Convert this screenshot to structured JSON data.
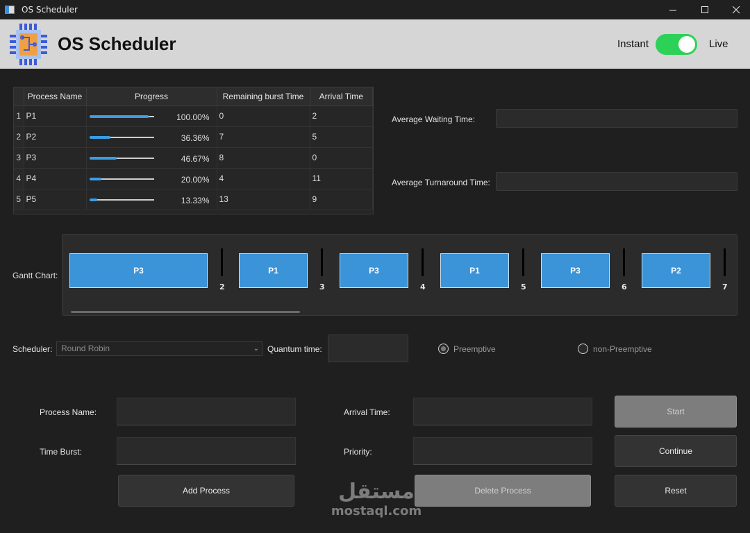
{
  "window": {
    "title": "OS Scheduler",
    "min_icon": "minimize-icon",
    "max_icon": "maximize-icon",
    "close_icon": "close-icon"
  },
  "header": {
    "title": "OS Scheduler",
    "mode_left": "Instant",
    "mode_right": "Live",
    "live_enabled": true,
    "logo_icon": "cpu-chip-icon"
  },
  "table": {
    "columns": [
      "Process Name",
      "Progress",
      "Remaining burst Time",
      "Arrival Time"
    ],
    "rows": [
      {
        "num": "1",
        "name": "P1",
        "progress": 1.0,
        "progress_text": "100.00%",
        "remaining": "0",
        "arrival": "2"
      },
      {
        "num": "2",
        "name": "P2",
        "progress": 0.3636,
        "progress_text": "36.36%",
        "remaining": "7",
        "arrival": "5"
      },
      {
        "num": "3",
        "name": "P3",
        "progress": 0.4667,
        "progress_text": "46.67%",
        "remaining": "8",
        "arrival": "0"
      },
      {
        "num": "4",
        "name": "P4",
        "progress": 0.2,
        "progress_text": "20.00%",
        "remaining": "4",
        "arrival": "11"
      },
      {
        "num": "5",
        "name": "P5",
        "progress": 0.1333,
        "progress_text": "13.33%",
        "remaining": "13",
        "arrival": "9"
      }
    ]
  },
  "averages": {
    "waiting_label": "Average Waiting Time:",
    "waiting_value": "",
    "turnaround_label": "Average Turnaround Time:",
    "turnaround_value": ""
  },
  "gantt": {
    "label": "Gantt Chart:",
    "blocks": [
      {
        "name": "P3",
        "end": "2"
      },
      {
        "name": "P1",
        "end": "3"
      },
      {
        "name": "P3",
        "end": "4"
      },
      {
        "name": "P1",
        "end": "5"
      },
      {
        "name": "P3",
        "end": "6"
      },
      {
        "name": "P2",
        "end": "7"
      }
    ]
  },
  "scheduler": {
    "label": "Scheduler:",
    "selected": "Round Robin",
    "quantum_label": "Quantum time:",
    "quantum_value": "",
    "preemptive_label": "Preemptive",
    "non_preemptive_label": "non-Preemptive",
    "preemptive_selected": true
  },
  "form": {
    "process_name_label": "Process Name:",
    "time_burst_label": "Time Burst:",
    "arrival_time_label": "Arrival Time:",
    "priority_label": "Priority:",
    "process_name_value": "",
    "time_burst_value": "",
    "arrival_time_value": "",
    "priority_value": ""
  },
  "buttons": {
    "add": "Add Process",
    "delete": "Delete Process",
    "start": "Start",
    "continue": "Continue",
    "reset": "Reset"
  },
  "watermark": {
    "arabic": "مستقل",
    "latin": "mostaql.com"
  },
  "colors": {
    "accent": "#3b93d8",
    "toggle_on": "#2ed158",
    "background": "#1f1f1f",
    "header_band": "#d6d6d6"
  }
}
